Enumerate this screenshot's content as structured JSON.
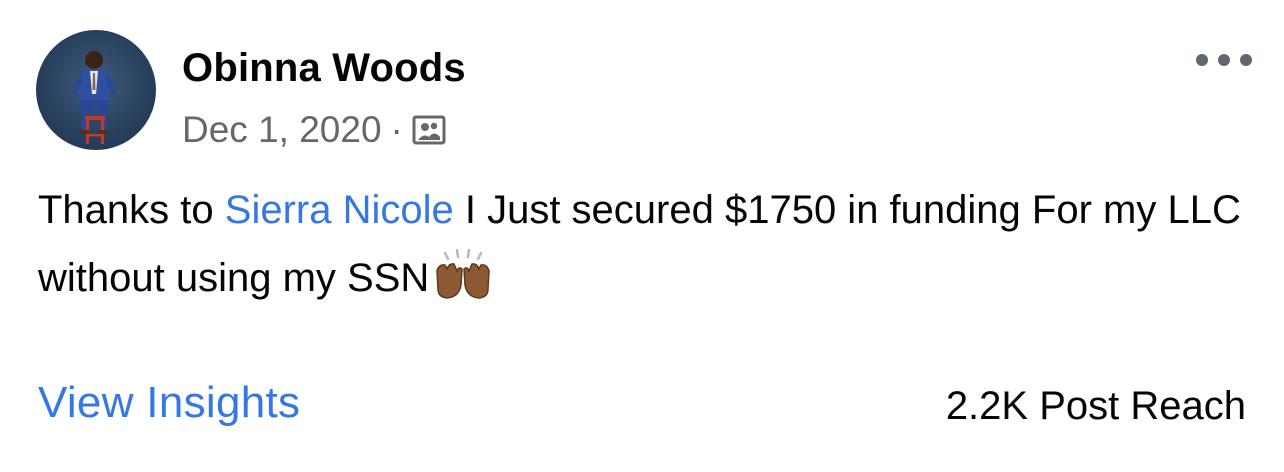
{
  "post": {
    "author": "Obinna Woods",
    "date": "Dec 1, 2020",
    "separator": "·",
    "audience_icon": "friends-audience-icon",
    "more_icon": "more-options-icon",
    "text_before": "Thanks to ",
    "mention": "Sierra Nicole",
    "text_after": " I Just secured $1750 in funding For my LLC without using my SSN",
    "emoji_icon": "raising-hands-emoji",
    "insights_label": "View Insights",
    "reach_label": "2.2K Post Reach"
  },
  "colors": {
    "link": "#3578e5",
    "text": "#050505",
    "meta": "#65676b",
    "avatar_bg": "#2a4260"
  }
}
